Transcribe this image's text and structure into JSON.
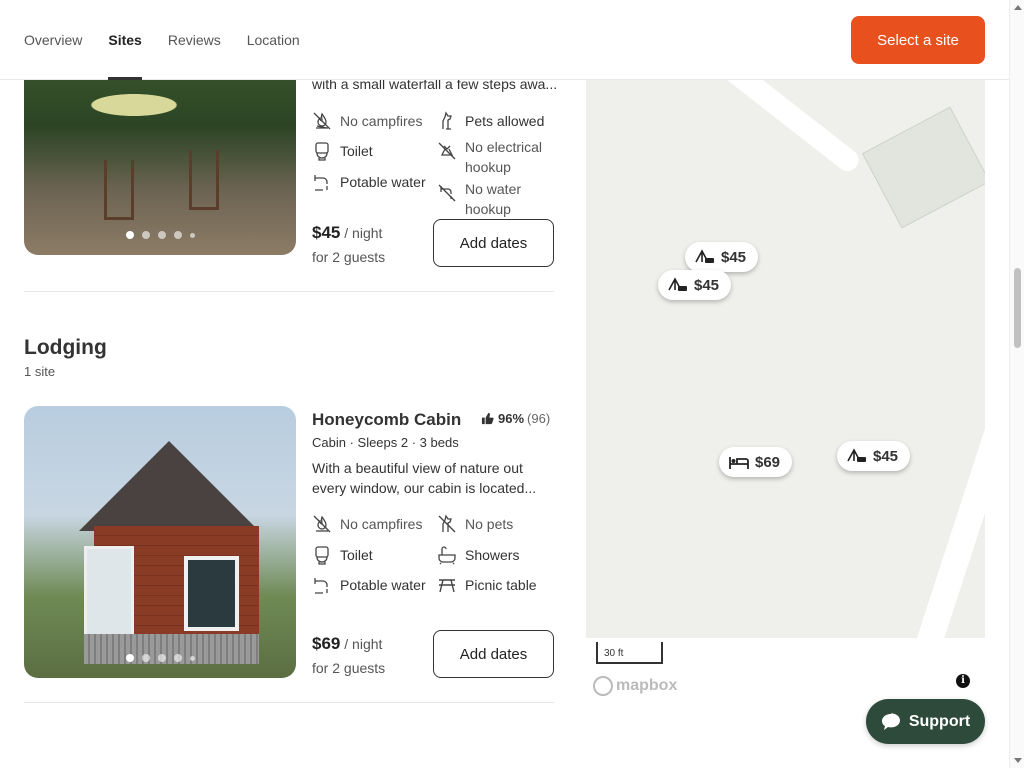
{
  "nav": {
    "tabs": [
      {
        "label": "Overview"
      },
      {
        "label": "Sites"
      },
      {
        "label": "Reviews"
      },
      {
        "label": "Location"
      }
    ],
    "active_tab": "Sites",
    "cta_label": "Select a site",
    "cta_color": "#e8501e"
  },
  "site1": {
    "desc_tail": "with a small waterfall a few steps awa...",
    "amenities": [
      {
        "icon": "no-campfire-icon",
        "label": "No campfires"
      },
      {
        "icon": "pet-icon",
        "label": "Pets allowed"
      },
      {
        "icon": "toilet-icon",
        "label": "Toilet"
      },
      {
        "icon": "no-electric-icon",
        "label": "No electrical hookup"
      },
      {
        "icon": "faucet-icon",
        "label": "Potable water"
      },
      {
        "icon": "no-water-hookup-icon",
        "label": "No water hookup"
      }
    ],
    "price": "$45",
    "per": "/ night",
    "guests": "for 2 guests",
    "button": "Add dates",
    "photo_dots": 5,
    "active_dot": 1
  },
  "lodging": {
    "title": "Lodging",
    "count": "1 site"
  },
  "site2": {
    "name": "Honeycomb Cabin",
    "rating_pct": "96%",
    "rating_count": "(96)",
    "meta": "Cabin · Sleeps 2 · 3 beds",
    "desc_line1": "With a beautiful view of nature out",
    "desc_line2": "every window, our cabin is located...",
    "amenities": [
      {
        "icon": "no-campfire-icon",
        "label": "No campfires"
      },
      {
        "icon": "no-pets-icon",
        "label": "No pets"
      },
      {
        "icon": "toilet-icon",
        "label": "Toilet"
      },
      {
        "icon": "shower-icon",
        "label": "Showers"
      },
      {
        "icon": "faucet-icon",
        "label": "Potable water"
      },
      {
        "icon": "picnic-table-icon",
        "label": "Picnic table"
      }
    ],
    "price": "$69",
    "per": "/ night",
    "guests": "for 2 guests",
    "button": "Add dates",
    "photo_dots": 5,
    "active_dot": 1
  },
  "map": {
    "pins": [
      {
        "icon": "tent-car-icon",
        "price": "$45"
      },
      {
        "icon": "tent-car-icon",
        "price": "$45"
      },
      {
        "icon": "bed-icon",
        "price": "$69"
      },
      {
        "icon": "tent-car-icon",
        "price": "$45"
      }
    ],
    "scale_label": "30 ft",
    "attribution": "mapbox",
    "info_glyph": "i"
  },
  "support": {
    "label": "Support",
    "color": "#2e4a3a"
  }
}
